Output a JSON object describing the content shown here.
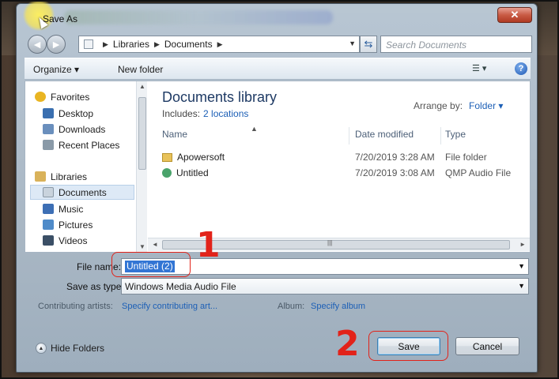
{
  "window": {
    "title": "Save As",
    "close_label": "✕"
  },
  "nav": {
    "back_icon": "◄",
    "forward_icon": "►",
    "path": [
      "Libraries",
      "Documents"
    ],
    "search_placeholder": "Search Documents"
  },
  "toolbar": {
    "organize_label": "Organize ▾",
    "new_folder_label": "New folder",
    "view_label": "☰ ▾",
    "help_label": "?"
  },
  "sidebar": {
    "items": [
      {
        "label": "Favorites",
        "icon": "star-icon",
        "color": "#e9b522"
      },
      {
        "label": "Desktop",
        "icon": "desktop-icon",
        "color": "#3a6fb0"
      },
      {
        "label": "Downloads",
        "icon": "downloads-icon",
        "color": "#6a8fbd"
      },
      {
        "label": "Recent Places",
        "icon": "recent-places-icon",
        "color": "#8a9aa8"
      },
      {
        "label": "Libraries",
        "icon": "libraries-icon",
        "color": "#d9b25a"
      },
      {
        "label": "Documents",
        "icon": "documents-icon",
        "color": "#c9d3dd"
      },
      {
        "label": "Music",
        "icon": "music-icon",
        "color": "#3d6fb5"
      },
      {
        "label": "Pictures",
        "icon": "pictures-icon",
        "color": "#4f8bc9"
      },
      {
        "label": "Videos",
        "icon": "videos-icon",
        "color": "#3b4f66"
      }
    ],
    "selected": "Documents"
  },
  "library": {
    "title": "Documents library",
    "includes_label": "Includes:",
    "includes_link": "2 locations",
    "arrange_label": "Arrange by:",
    "arrange_value": "Folder ▾"
  },
  "columns": {
    "name": "Name",
    "date": "Date modified",
    "type": "Type"
  },
  "files": [
    {
      "name": "Apowersoft",
      "date": "7/20/2019 3:28 AM",
      "type": "File folder",
      "icon": "folder-icon"
    },
    {
      "name": "Untitled",
      "date": "7/20/2019 3:08 AM",
      "type": "QMP Audio File",
      "icon": "audio-file-icon"
    }
  ],
  "form": {
    "filename_label": "File name:",
    "filename_value": "Untitled (2)",
    "savetype_label": "Save as type:",
    "savetype_value": "Windows Media Audio File",
    "artists_label": "Contributing artists:",
    "artists_link": "Specify contributing art...",
    "album_label": "Album:",
    "album_link": "Specify album"
  },
  "footer": {
    "hide_folders_label": "Hide Folders",
    "save_label": "Save",
    "cancel_label": "Cancel"
  },
  "annotations": {
    "step1": "1",
    "step2": "2",
    "color": "#e2231a"
  }
}
